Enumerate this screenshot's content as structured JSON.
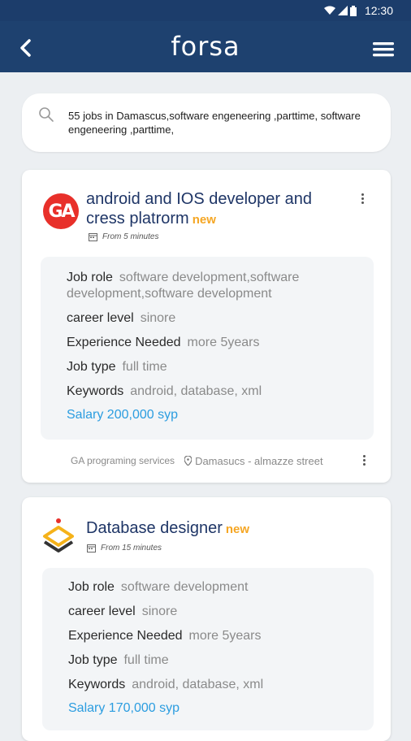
{
  "status": {
    "time": "12:30"
  },
  "appbar": {
    "logo": "forsa"
  },
  "search": {
    "text": "55 jobs in Damascus,software engeneering ,parttime, software engeneering ,parttime,"
  },
  "jobs": [
    {
      "title": "android and IOS developer and cress platrorm",
      "badge": "new",
      "posted": "From 5 minutes",
      "logo_text": "GA",
      "job_role_label": "Job role",
      "job_role": "software development,software development,software development",
      "career_level_label": "career level",
      "career_level": "sinore",
      "experience_label": "Experience Needed",
      "experience": "more 5years",
      "job_type_label": "Job type",
      "job_type": "full time",
      "keywords_label": "Keywords",
      "keywords": "android, database, xml",
      "salary": "Salary 200,000 syp",
      "company": "GA programing services",
      "location": "Damasucs - almazze street"
    },
    {
      "title": "Database designer",
      "badge": "new",
      "posted": "From 15 minutes",
      "job_role_label": "Job role",
      "job_role": "software development",
      "career_level_label": "career level",
      "career_level": "sinore",
      "experience_label": "Experience Needed",
      "experience": "more 5years",
      "job_type_label": "Job type",
      "job_type": "full time",
      "keywords_label": "Keywords",
      "keywords": "android, database, xml",
      "salary": "Salary 170,000 syp"
    }
  ],
  "colors": {
    "appbar": "#1e416f",
    "title": "#1e3566",
    "badge": "#f5a623",
    "salary": "#2b9de0",
    "ga_logo": "#e8302a"
  },
  "icons": [
    "wifi-icon",
    "signal-icon",
    "battery-icon",
    "back-arrow-icon",
    "hamburger-menu-icon",
    "search-icon",
    "calendar-icon",
    "location-pin-icon",
    "more-vertical-icon"
  ]
}
